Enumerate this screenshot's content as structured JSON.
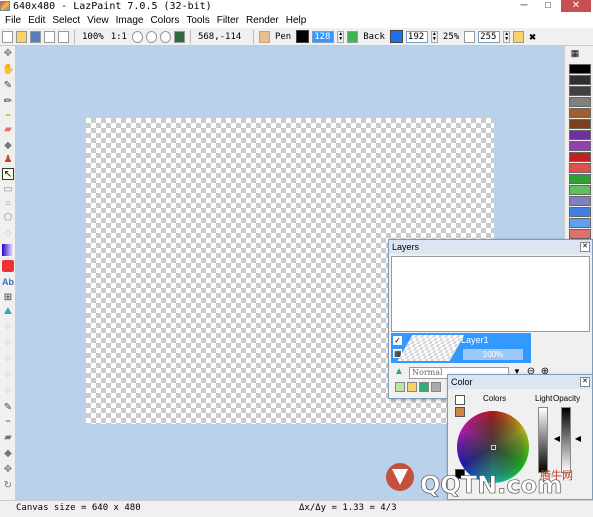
{
  "window": {
    "title": "640x480 - LazPaint 7.0.5 (32-bit)",
    "minimize": "─",
    "maximize": "□",
    "close": "✕"
  },
  "menu": [
    "File",
    "Edit",
    "Select",
    "View",
    "Image",
    "Colors",
    "Tools",
    "Filter",
    "Render",
    "Help"
  ],
  "toolbar": {
    "zoom": "100%",
    "zoom_ratio": "1:1",
    "coords": "568,-114",
    "pen_label": "Pen",
    "pen_color": "#000000",
    "pen_alpha": "128",
    "back_label": "Back",
    "back_color": "#1e6fe8",
    "back_alpha": "192",
    "tolerance": "25%",
    "opacity": "255"
  },
  "palette_colors": [
    "#000000",
    "#303030",
    "#404040",
    "#808080",
    "#a06030",
    "#804020",
    "#7030a0",
    "#9040b0",
    "#c02020",
    "#e05050",
    "#30a030",
    "#60c060",
    "#8080c0",
    "#4080e0",
    "#60a0f0",
    "#e07070",
    "#f0a060",
    "#80b0e0",
    "#c0c0c0",
    "#e0e0e0"
  ],
  "layers_panel": {
    "title": "Layers",
    "close": "✕",
    "layer_name": "Layer1",
    "layer_opacity": "100%",
    "blend_mode": "Normal"
  },
  "color_panel": {
    "title": "Color",
    "close": "✕",
    "colors_label": "Colors",
    "light_label": "Light",
    "opacity_label": "Opacity"
  },
  "status": {
    "canvas_size": "Canvas size = 640 x 480",
    "ratio": "Δx/Δy = 1.33 = 4/3"
  },
  "watermark": {
    "brand": "QQTN.com",
    "chinese": "腾牛网"
  }
}
